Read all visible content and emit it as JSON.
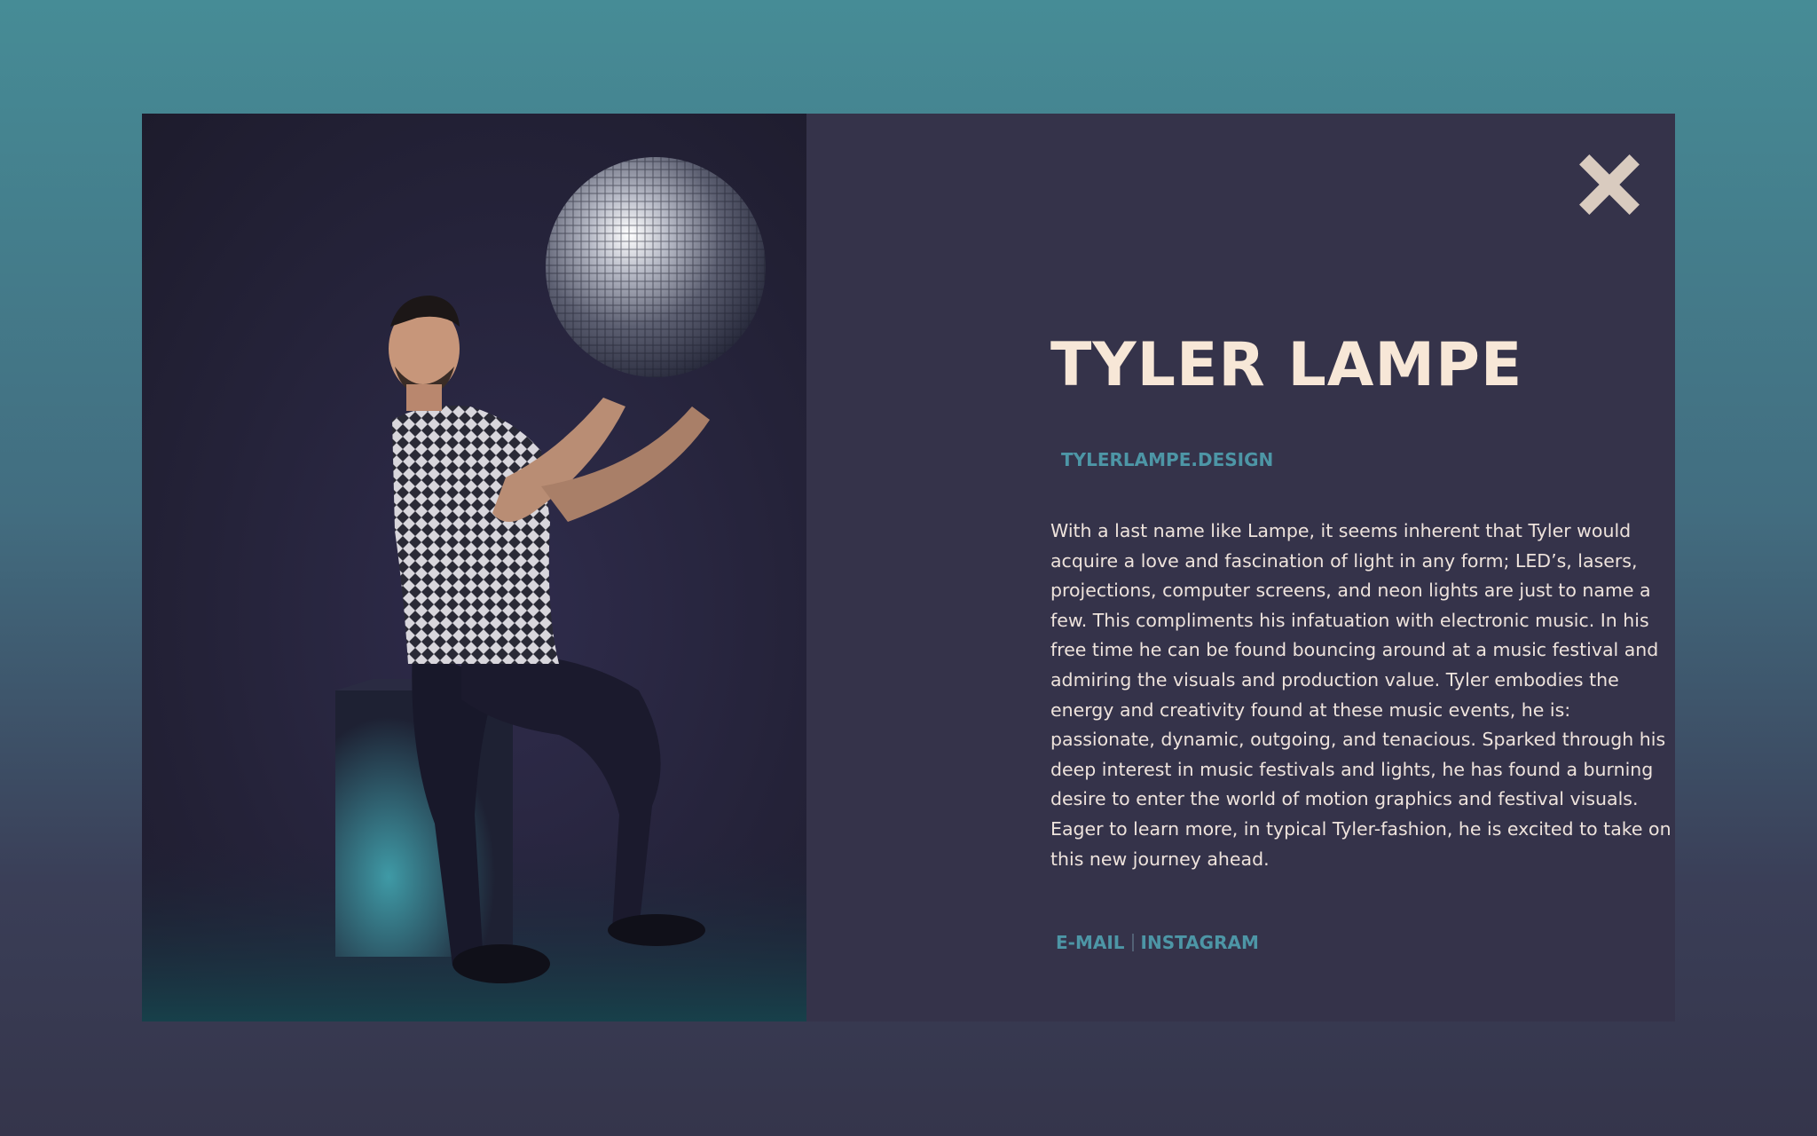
{
  "profile": {
    "name": "TYLER LAMPE",
    "website": "TYLERLAMPE.DESIGN",
    "bio": "With a last name like Lampe, it seems inherent that Tyler would acquire a love and fascination of light in any form; LED’s, lasers, projections, computer screens, and neon lights are just to name a few. This compliments his infatuation with electronic music. In his free time he can be found bouncing around at a music festival and admiring the visuals and production value. Tyler embodies the energy and creativity found at these music events, he is: passionate, dynamic, outgoing, and tenacious. Sparked through his deep interest in music festivals and lights, he has found a burning desire to enter the world of motion graphics and festival visuals. Eager to learn more, in typical Tyler-fashion, he is excited to take on this new journey ahead."
  },
  "links": {
    "email": "E-MAIL",
    "instagram": "INSTAGRAM"
  },
  "icons": {
    "close": "close-icon"
  },
  "colors": {
    "background_top": "#468c96",
    "background_bottom": "#35354b",
    "modal": "#35334a",
    "name": "#f7e7d7",
    "accent": "#4d96a6",
    "body_text": "#eee3dc",
    "close_icon": "#d9cbbf"
  }
}
